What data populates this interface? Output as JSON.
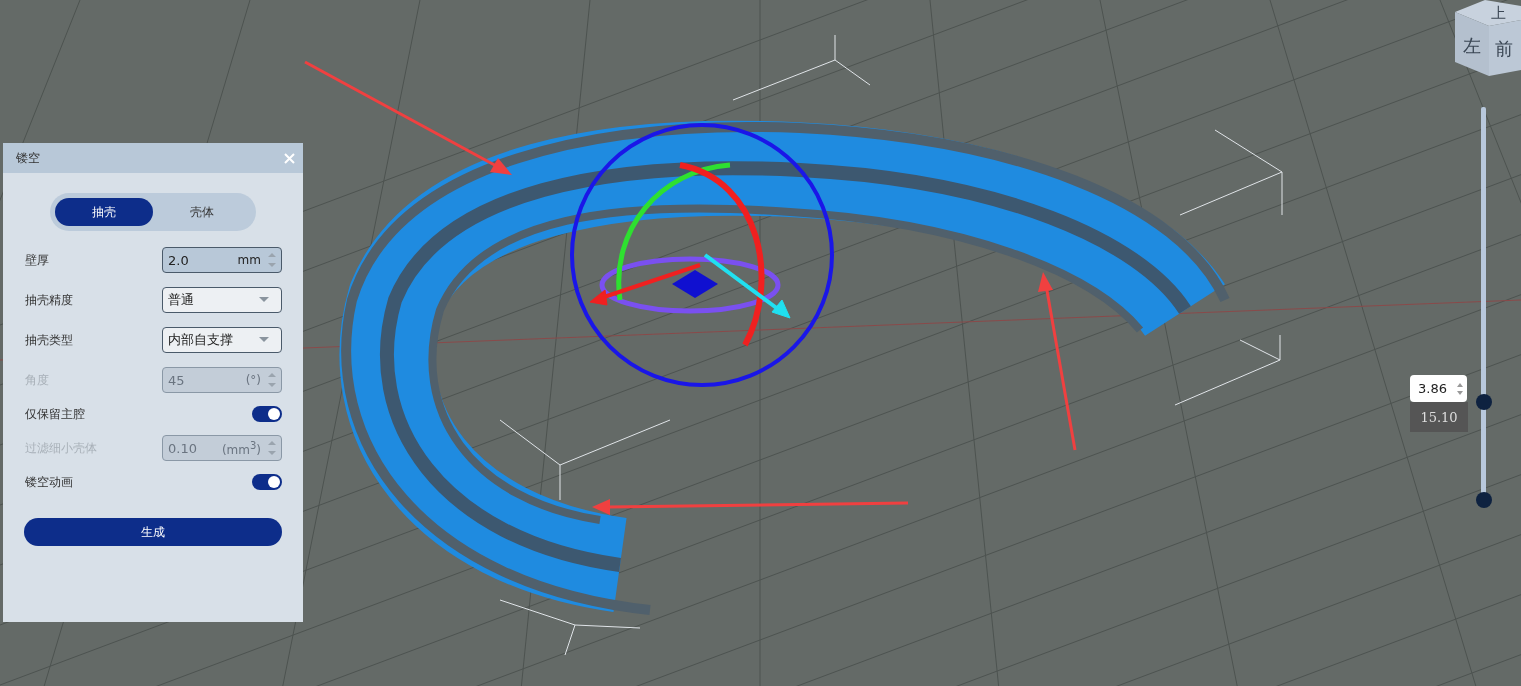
{
  "panel": {
    "title": "镂空",
    "tabs": [
      {
        "label": "抽壳",
        "selected": true
      },
      {
        "label": "壳体",
        "selected": false
      }
    ],
    "rows": [
      {
        "kind": "number",
        "label": "壁厚",
        "value": "2.0",
        "unit": "mm",
        "disabled": false
      },
      {
        "kind": "select",
        "label": "抽壳精度",
        "value": "普通"
      },
      {
        "kind": "select",
        "label": "抽壳类型",
        "value": "内部自支撑"
      },
      {
        "kind": "number",
        "label": "角度",
        "value": "45",
        "unit": "(°)",
        "disabled": true
      },
      {
        "kind": "toggle",
        "label": "仅保留主腔",
        "on": true
      },
      {
        "kind": "number",
        "label": "过滤细小壳体",
        "value": "0.10",
        "unit": "(mm$^{3}$)",
        "disabled": true
      },
      {
        "kind": "toggle",
        "label": "镂空动画",
        "on": true
      }
    ],
    "button": "生成"
  },
  "view_cube": {
    "top": "上",
    "front": "前",
    "left": "左"
  },
  "layer_slider": {
    "value": "3.86",
    "reading": "15.10",
    "thumbs": [
      {
        "level": 0.25
      },
      {
        "level": 0
      }
    ]
  }
}
